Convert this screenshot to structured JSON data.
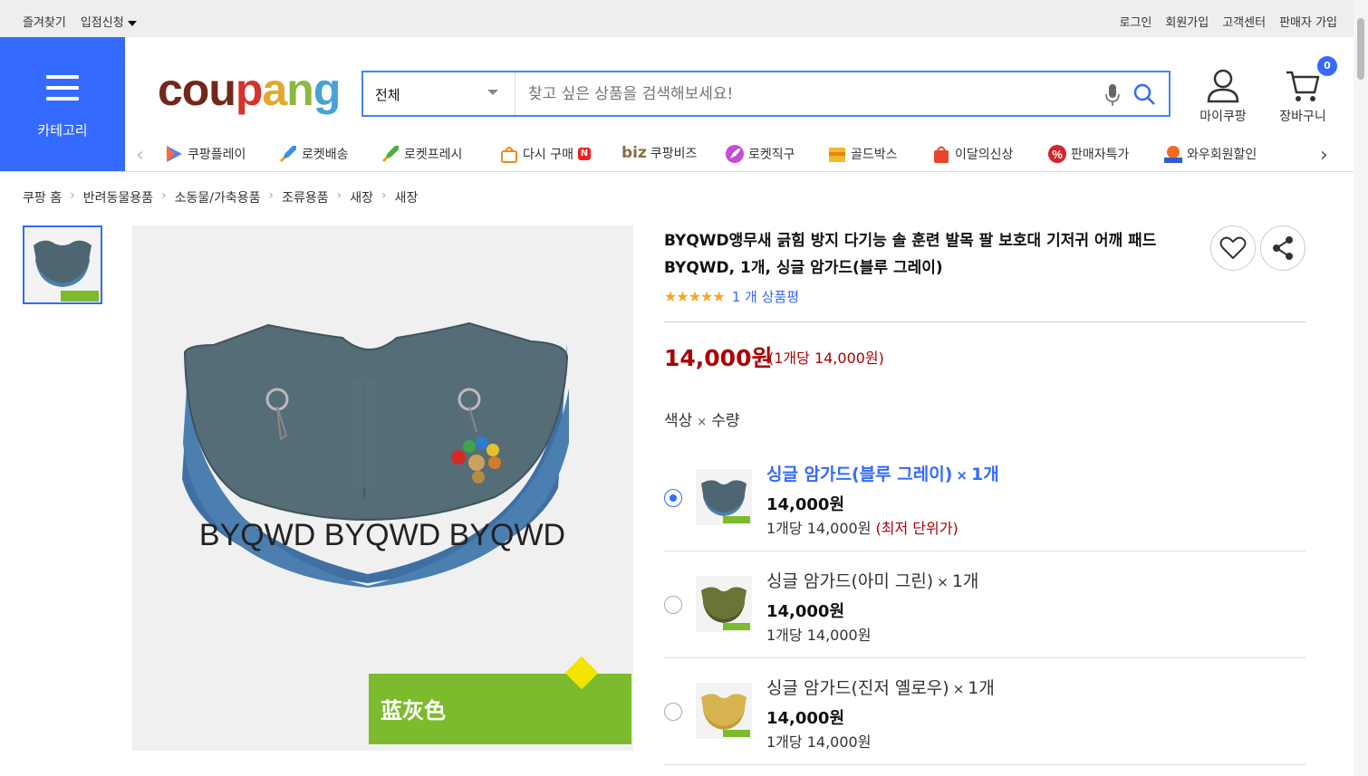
{
  "topbar": {
    "left": [
      "즐겨찾기",
      "입점신청"
    ],
    "right": [
      "로그인",
      "회원가입",
      "고객센터",
      "판매자 가입"
    ]
  },
  "header": {
    "category_label": "카테고리",
    "logo": "coupang",
    "search_scope": "전체",
    "search_placeholder": "찾고 싶은 상품을 검색해보세요!",
    "mycoupang_label": "마이쿠팡",
    "cart_label": "장바구니",
    "cart_count": "0"
  },
  "menu": [
    "쿠팡플레이",
    "로켓배송",
    "로켓프레시",
    "다시 구매",
    "쿠팡비즈",
    "로켓직구",
    "골드박스",
    "이달의신상",
    "판매자특가",
    "와우회원할인"
  ],
  "menu_badges": {
    "rebuy": "N",
    "biz_prefix": "biz"
  },
  "breadcrumb": [
    "쿠팡 홈",
    "반려동물용품",
    "소동물/가축용품",
    "조류용품",
    "새장",
    "새장"
  ],
  "product": {
    "title": "BYQWD앵무새 긁힘 방지 다기능 솔 훈련 발목 팔 보호대 기저귀 어깨 패드BYQWD, 1개, 싱글 암가드(블루 그레이)",
    "stars": "★★★★★",
    "review_count": "1 개 상품평",
    "price": "14,000원",
    "unit_price": "(1개당 14,000원)",
    "image_watermark": "BYQWD BYQWD BYQWD",
    "image_tag": "蓝灰色",
    "option_label_a": "색상",
    "option_label_x": "×",
    "option_label_b": "수량"
  },
  "options": [
    {
      "name": "싱글 암가드(블루 그레이)",
      "qty": "1개",
      "price": "14,000원",
      "unit": "1개당 14,000원",
      "lowest": "(최저 단위가)",
      "selected": true,
      "color": "#4e6672"
    },
    {
      "name": "싱글 암가드(아미 그린)",
      "qty": "1개",
      "price": "14,000원",
      "unit": "1개당 14,000원",
      "lowest": "",
      "selected": false,
      "color": "#6a7535"
    },
    {
      "name": "싱글 암가드(진저 옐로우)",
      "qty": "1개",
      "price": "14,000원",
      "unit": "1개당 14,000원",
      "lowest": "",
      "selected": false,
      "color": "#d8b451"
    }
  ],
  "colors": {
    "accent": "#346aff",
    "price_red": "#ae0000"
  }
}
